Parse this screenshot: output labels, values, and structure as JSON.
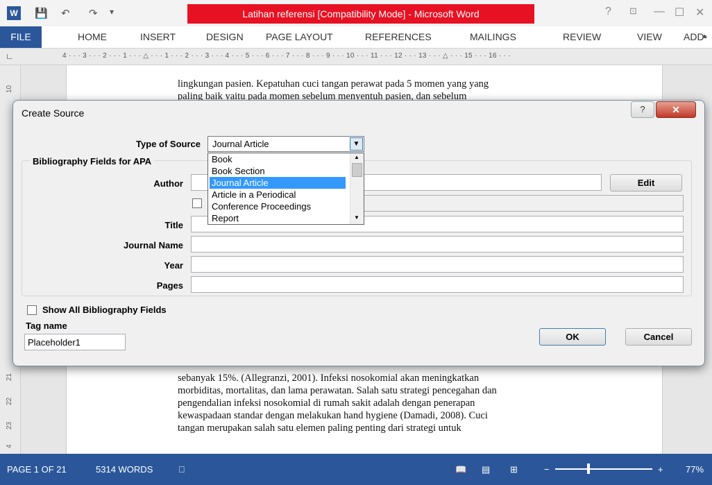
{
  "window": {
    "title": "Latihan referensi [Compatibility Mode] -  Microsoft Word",
    "help": "?",
    "min": "—",
    "max": "☐",
    "close": "✕"
  },
  "ribbon": {
    "file": "FILE",
    "tabs": [
      "HOME",
      "INSERT",
      "DESIGN",
      "PAGE LAYOUT",
      "REFERENCES",
      "MAILINGS",
      "REVIEW",
      "VIEW",
      "ADD-"
    ]
  },
  "ruler": {
    "text": "4 · · · 3 · · · 2 · · · 1 · · · △ · · · 1 · · · 2 · · · 3 · · · 4 · · · 5 · · · 6 · · · 7 · · · 8 · · · 9 · · · 10 · · · 11 · · · 12 · · · 13 · · · △ · · · 15 · · · 16 · · ·",
    "vmarks": [
      "10",
      "21",
      "22",
      "23",
      "4"
    ]
  },
  "document": {
    "top_lines": [
      "lingkungan pasien. Kepatuhan cuci tangan perawat pada 5 momen yang yang",
      "paling baik yaitu pada momen sebelum menyentuh pasien, dan sebelum"
    ],
    "bottom_lines": [
      "sebanyak 15%.   (Allegranzi, 2001). Infeksi nosokomial akan meningkatkan",
      "morbiditas, mortalitas, dan lama perawatan. Salah satu strategi pencegahan dan",
      "pengendalian infeksi nosokomial di rumah sakit adalah dengan penerapan",
      "kewaspadaan standar dengan melakukan hand hygiene (Damadi, 2008). Cuci",
      "tangan merupakan salah satu elemen paling penting dari strategi untuk"
    ]
  },
  "dialog": {
    "title": "Create Source",
    "type_label": "Type of Source",
    "type_value": "Journal Article",
    "group_label": "Bibliography Fields for APA",
    "author_label": "Author",
    "edit_button": "Edit",
    "title_label": "Title",
    "journal_label": "Journal Name",
    "year_label": "Year",
    "pages_label": "Pages",
    "show_all": "Show All Bibliography Fields",
    "tag_label": "Tag name",
    "tag_value": "Placeholder1",
    "ok_button": "OK",
    "cancel_button": "Cancel",
    "options": [
      "Book",
      "Book Section",
      "Journal Article",
      "Article in a Periodical",
      "Conference Proceedings",
      "Report"
    ],
    "selected_option": "Journal Article"
  },
  "status": {
    "page": "PAGE 1 OF 21",
    "words": "5314 WORDS",
    "zoom": "77%"
  },
  "colors": {
    "word_blue": "#2b579a",
    "title_red": "#e81123",
    "select_blue": "#3399ff"
  }
}
